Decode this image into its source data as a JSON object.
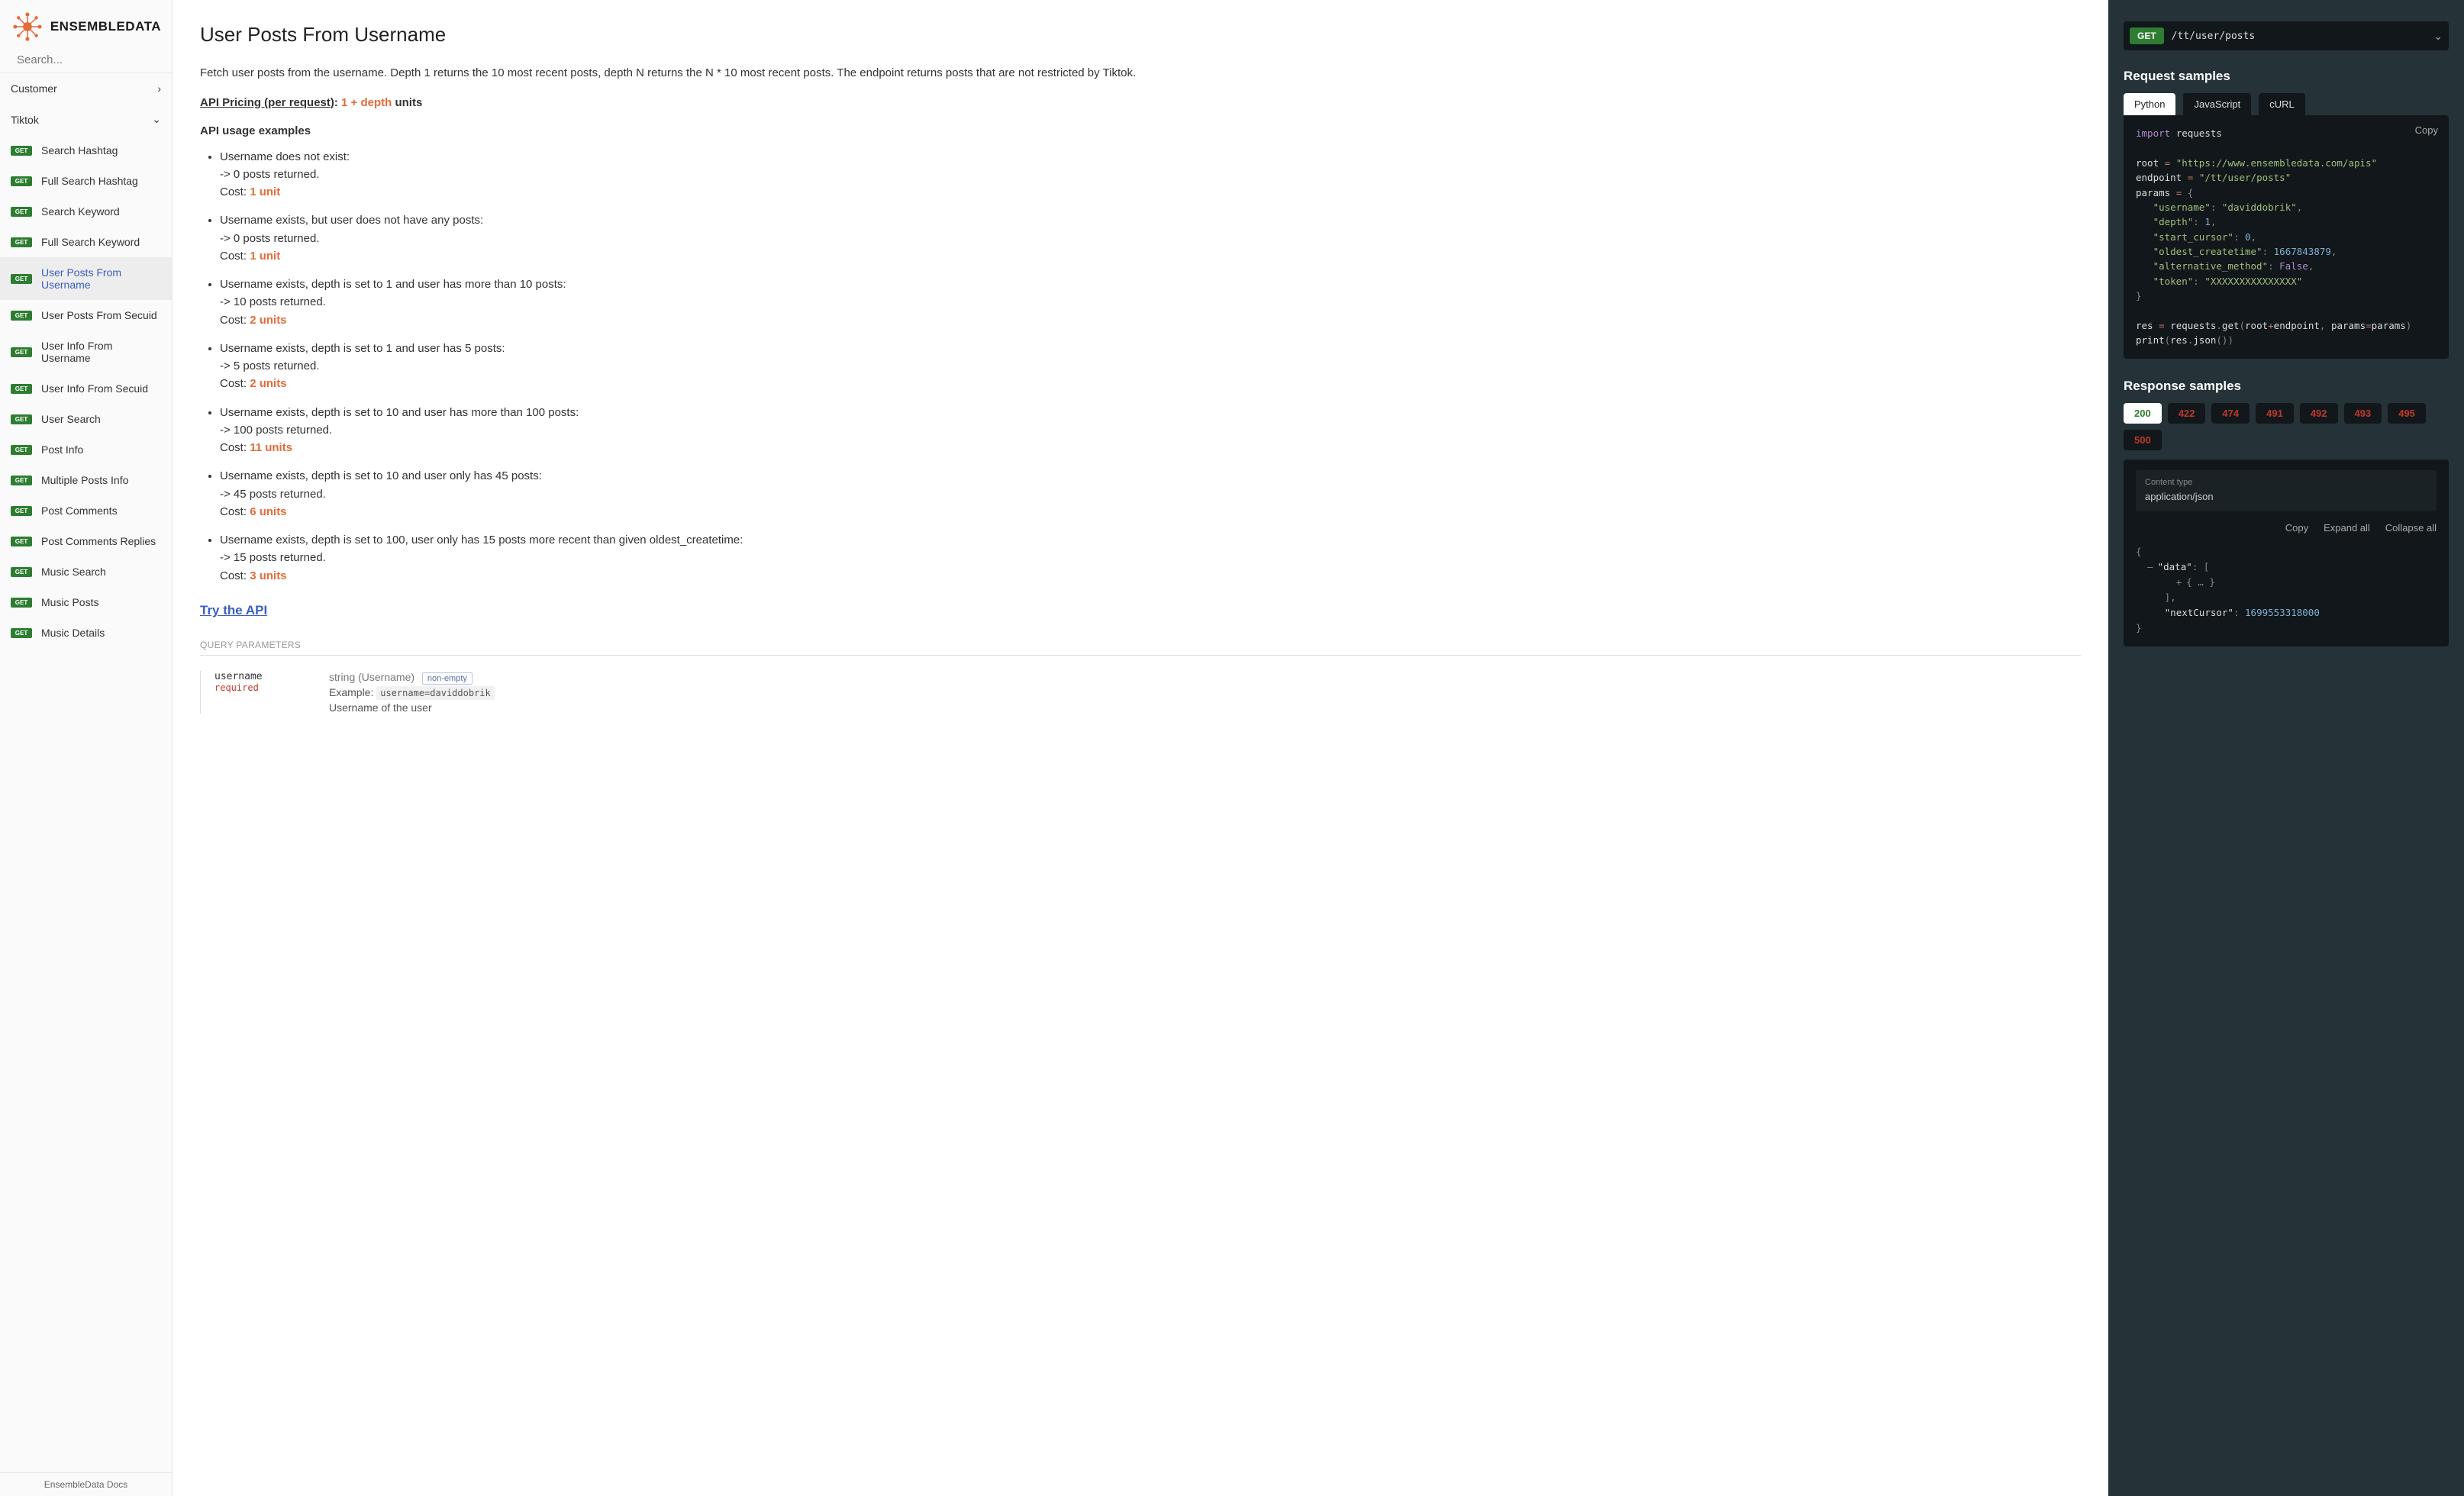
{
  "brand": "ENSEMBLEDATA",
  "search_placeholder": "Search...",
  "sections": {
    "customer": "Customer",
    "tiktok": "Tiktok"
  },
  "nav_items": [
    {
      "method": "GET",
      "label": "Search Hashtag"
    },
    {
      "method": "GET",
      "label": "Full Search Hashtag"
    },
    {
      "method": "GET",
      "label": "Search Keyword"
    },
    {
      "method": "GET",
      "label": "Full Search Keyword"
    },
    {
      "method": "GET",
      "label": "User Posts From Username"
    },
    {
      "method": "GET",
      "label": "User Posts From Secuid"
    },
    {
      "method": "GET",
      "label": "User Info From Username"
    },
    {
      "method": "GET",
      "label": "User Info From Secuid"
    },
    {
      "method": "GET",
      "label": "User Search"
    },
    {
      "method": "GET",
      "label": "Post Info"
    },
    {
      "method": "GET",
      "label": "Multiple Posts Info"
    },
    {
      "method": "GET",
      "label": "Post Comments"
    },
    {
      "method": "GET",
      "label": "Post Comments Replies"
    },
    {
      "method": "GET",
      "label": "Music Search"
    },
    {
      "method": "GET",
      "label": "Music Posts"
    },
    {
      "method": "GET",
      "label": "Music Details"
    }
  ],
  "footer": "EnsembleData Docs",
  "title": "User Posts From Username",
  "description": "Fetch user posts from the username. Depth 1 returns the 10 most recent posts, depth N returns the N * 10 most recent posts. The endpoint returns posts that are not restricted by Tiktok.",
  "pricing_label": "API Pricing (per request)",
  "pricing_formula": "1 + depth",
  "pricing_units": "units",
  "usage_header": "API usage examples",
  "examples": [
    {
      "title": "Username does not exist:",
      "result": "0 posts returned.",
      "cost": "1 unit"
    },
    {
      "title": "Username exists, but user does not have any posts:",
      "result": "0 posts returned.",
      "cost": "1 unit"
    },
    {
      "title": "Username exists, depth is set to 1 and user has more than 10 posts:",
      "result": "10 posts returned.",
      "cost": "2 units"
    },
    {
      "title": "Username exists, depth is set to 1 and user has 5 posts:",
      "result": "5 posts returned.",
      "cost": "2 units"
    },
    {
      "title": "Username exists, depth is set to 10 and user has more than 100 posts:",
      "result": "100 posts returned.",
      "cost": "11 units"
    },
    {
      "title": "Username exists, depth is set to 10 and user only has 45 posts:",
      "result": "45 posts returned.",
      "cost": "6 units"
    },
    {
      "title": "Username exists, depth is set to 100, user only has 15 posts more recent than given oldest_createtime:",
      "result": "15 posts returned.",
      "cost": "3 units"
    }
  ],
  "try_label": "Try the API",
  "query_params_header": "QUERY PARAMETERS",
  "param": {
    "name": "username",
    "required": "required",
    "type": "string (Username)",
    "nonempty": "non-empty",
    "example_label": "Example:",
    "example_code": "username=daviddobrik",
    "desc": "Username of the user"
  },
  "endpoint": {
    "method": "GET",
    "path": "/tt/user/posts"
  },
  "req_samples_header": "Request samples",
  "req_tabs": [
    "Python",
    "JavaScript",
    "cURL"
  ],
  "copy_label": "Copy",
  "code": {
    "root_url": "\"https://www.ensembledata.com/apis\"",
    "endpoint_str": "\"/tt/user/posts\"",
    "username_val": "\"daviddobrik\"",
    "depth_val": "1",
    "cursor_val": "0",
    "oldest_val": "1667843879",
    "alt_val": "False",
    "token_val": "\"XXXXXXXXXXXXXXX\""
  },
  "resp_samples_header": "Response samples",
  "status_codes": [
    "200",
    "422",
    "474",
    "491",
    "492",
    "493",
    "495",
    "500"
  ],
  "content_type_label": "Content type",
  "content_type_val": "application/json",
  "resp_actions": [
    "Copy",
    "Expand all",
    "Collapse all"
  ],
  "resp_json": {
    "data_key": "\"data\"",
    "next_key": "\"nextCursor\"",
    "next_val": "1699553318000"
  }
}
